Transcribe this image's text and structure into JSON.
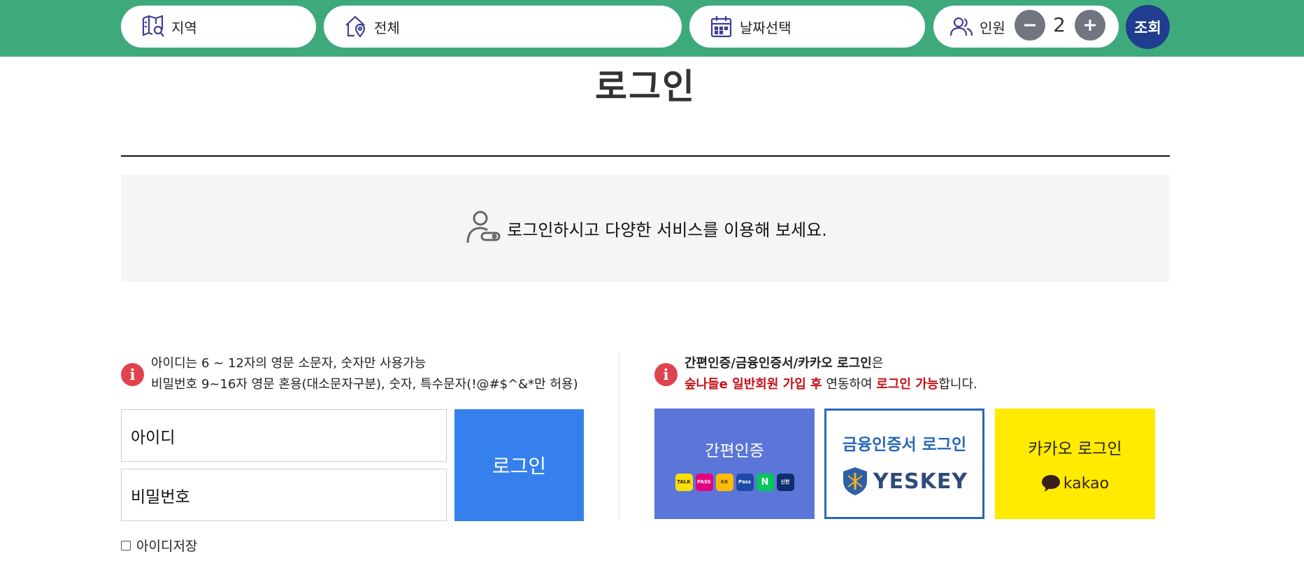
{
  "search_bar": {
    "region_label": "지역",
    "type_label": "전체",
    "date_label": "날짜선택",
    "people_label": "인원",
    "people_count": "2",
    "search_button": "조회"
  },
  "page": {
    "title": "로그인",
    "banner_text": "로그인하시고 다양한 서비스를 이용해 보세요."
  },
  "id_login": {
    "notice_line1": "아이디는 6 ~ 12자의 영문 소문자, 숫자만 사용가능",
    "notice_line2": "비밀번호 9~16자 영문 혼용(대소문자구분), 숫자, 특수문자(!@#$^&*만 허용)",
    "id_placeholder": "아이디",
    "password_placeholder": "비밀번호",
    "login_button": "로그인",
    "save_id_label": "아이디저장"
  },
  "alt_login": {
    "notice_l1_bold": "간편인증/금융인증서/카카오 로그인",
    "notice_l1_rest": "은",
    "notice_l2_red1": "숲나들e 일반회원 가입 후",
    "notice_l2_mid": " 연동하여 ",
    "notice_l2_red2": "로그인 가능",
    "notice_l2_end": "합니다.",
    "simple_auth_label": "간편인증",
    "simple_auth_providers": [
      "TALK",
      "PASS",
      "KB",
      "Pass",
      "N",
      "신한"
    ],
    "cert_label": "금융인증서 로그인",
    "cert_brand": "YESKEY",
    "kakao_label": "카카오 로그인",
    "kakao_brand": "kakao"
  },
  "colors": {
    "header_green": "#3eaa7c",
    "search_navy": "#203d8f",
    "login_blue": "#3580ec",
    "alert_red": "#e0434e",
    "simple_auth_blue": "#5b76d8",
    "cert_border": "#2a68b8",
    "kakao_yellow": "#ffeb00"
  },
  "icons": [
    "map-icon",
    "home-pin-icon",
    "calendar-icon",
    "people-icon",
    "minus-icon",
    "plus-icon",
    "user-key-icon",
    "info-icon"
  ]
}
